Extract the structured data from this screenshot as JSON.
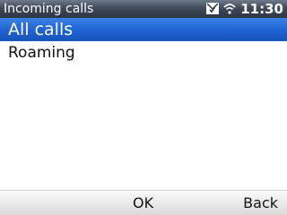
{
  "status_bar": {
    "title": "Incoming calls",
    "time": "11:30",
    "icons": [
      "message-icon",
      "wifi-icon"
    ]
  },
  "list": {
    "items": [
      {
        "label": "All calls",
        "selected": true
      },
      {
        "label": "Roaming",
        "selected": false
      }
    ]
  },
  "softkeys": {
    "left_label": "OK",
    "right_label": "Back"
  },
  "colors": {
    "selection": "#1f62d1",
    "status_bar": "#3f4a5a"
  }
}
